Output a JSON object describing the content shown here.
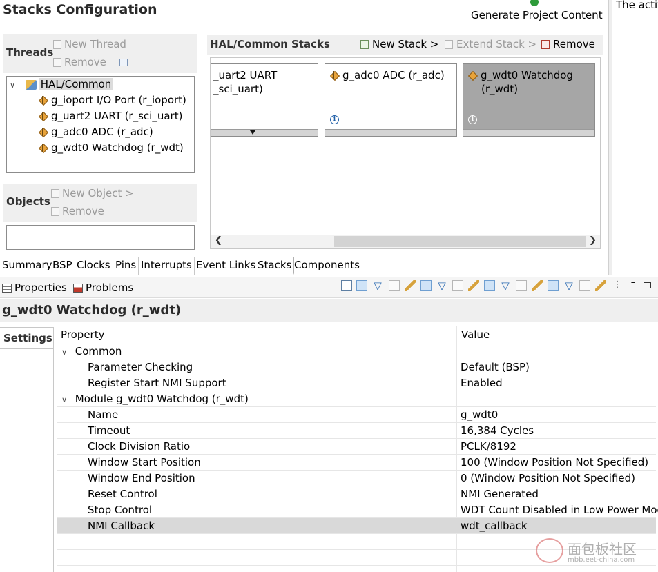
{
  "editor": {
    "title": "Stacks Configuration",
    "generate_label": "Generate Project Content",
    "right_panel_text": "The activ"
  },
  "threads": {
    "heading": "Threads",
    "new_thread": "New Thread",
    "remove": "Remove",
    "tree": {
      "root": "HAL/Common",
      "items": [
        "g_ioport I/O Port (r_ioport)",
        "g_uart2 UART (r_sci_uart)",
        "g_adc0 ADC (r_adc)",
        "g_wdt0 Watchdog (r_wdt)"
      ]
    }
  },
  "objects": {
    "heading": "Objects",
    "new_object": "New Object >",
    "remove": "Remove"
  },
  "stacks": {
    "heading": "HAL/Common Stacks",
    "new_stack": "New Stack >",
    "extend_stack": "Extend Stack >",
    "remove": "Remove",
    "cards": [
      {
        "line1": "_uart2 UART",
        "line2": "_sci_uart)"
      },
      {
        "line1": "g_adc0 ADC (r_adc)",
        "line2": ""
      },
      {
        "line1": "g_wdt0 Watchdog",
        "line2": "(r_wdt)"
      }
    ]
  },
  "editor_tabs": [
    "Summary",
    "BSP",
    "Clocks",
    "Pins",
    "Interrupts",
    "Event Links",
    "Stacks",
    "Components"
  ],
  "active_editor_tab": "Stacks",
  "views": {
    "properties_tab": "Properties",
    "problems_tab": "Problems"
  },
  "properties": {
    "title": "g_wdt0 Watchdog (r_wdt)",
    "side_tab": "Settings",
    "col_property": "Property",
    "col_value": "Value",
    "groups": [
      {
        "name": "Common",
        "rows": [
          {
            "name": "Parameter Checking",
            "value": "Default (BSP)"
          },
          {
            "name": "Register Start NMI Support",
            "value": "Enabled"
          }
        ]
      },
      {
        "name": "Module g_wdt0 Watchdog (r_wdt)",
        "rows": [
          {
            "name": "Name",
            "value": "g_wdt0"
          },
          {
            "name": "Timeout",
            "value": "16,384 Cycles"
          },
          {
            "name": "Clock Division Ratio",
            "value": "PCLK/8192"
          },
          {
            "name": "Window Start Position",
            "value": "100 (Window Position Not Specified)"
          },
          {
            "name": "Window End Position",
            "value": "0 (Window Position Not Specified)"
          },
          {
            "name": "Reset Control",
            "value": "NMI Generated"
          },
          {
            "name": "Stop Control",
            "value": "WDT Count Disabled in Low Power Mode"
          },
          {
            "name": "NMI Callback",
            "value": "wdt_callback"
          }
        ]
      }
    ],
    "selected_row": "NMI Callback"
  },
  "watermark": {
    "text": "面包板社区",
    "url": "mbb.eet-china.com"
  },
  "colors": {
    "panel_bg": "#efefef",
    "selected_card": "#a6a6a6",
    "selected_row": "#d9d9d9",
    "toolbar_blue": "#cfe3f7"
  }
}
